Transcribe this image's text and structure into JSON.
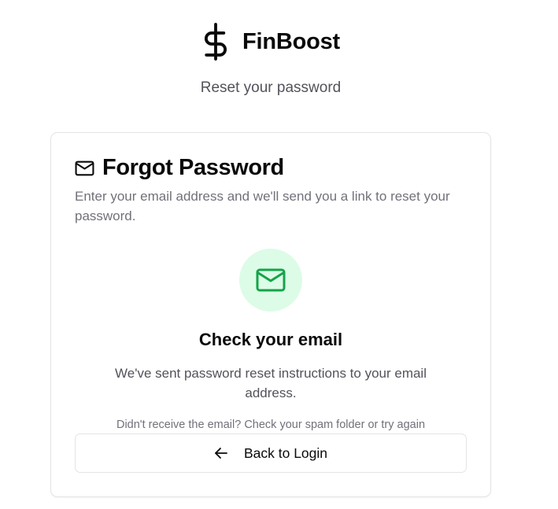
{
  "brand": {
    "name": "FinBoost",
    "icon": "dollar-sign-icon"
  },
  "subtitle": "Reset your password",
  "card": {
    "title": "Forgot Password",
    "title_icon": "mail-icon",
    "description": "Enter your email address and we'll send you a link to reset your password.",
    "status": {
      "icon": "mail-icon",
      "icon_color": "#16a34a",
      "icon_bg": "#dcfce7",
      "heading": "Check your email",
      "message": "We've sent password reset instructions to your email address.",
      "note": "Didn't receive the email? Check your spam folder or try again"
    },
    "back_button": {
      "label": "Back to Login",
      "icon": "arrow-left-icon"
    }
  }
}
